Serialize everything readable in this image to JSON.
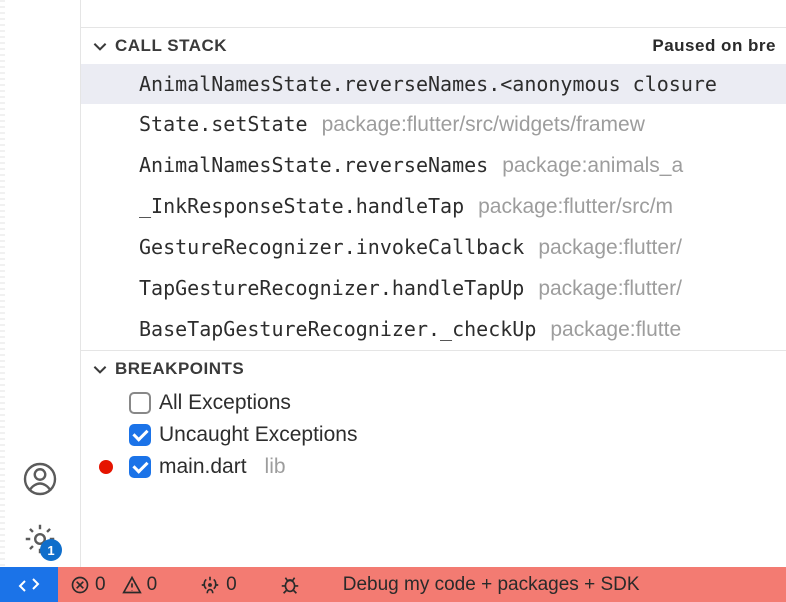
{
  "callStack": {
    "title": "CALL STACK",
    "status": "Paused on bre",
    "frames": [
      {
        "name": "AnimalNamesState.reverseNames.<anonymous closure",
        "pkg": "",
        "selected": true
      },
      {
        "name": "State.setState",
        "pkg": "package:flutter/src/widgets/framew"
      },
      {
        "name": "AnimalNamesState.reverseNames",
        "pkg": "package:animals_a"
      },
      {
        "name": "_InkResponseState.handleTap",
        "pkg": "package:flutter/src/m"
      },
      {
        "name": "GestureRecognizer.invokeCallback",
        "pkg": "package:flutter/"
      },
      {
        "name": "TapGestureRecognizer.handleTapUp",
        "pkg": "package:flutter/"
      },
      {
        "name": "BaseTapGestureRecognizer._checkUp",
        "pkg": "package:flutte"
      }
    ]
  },
  "breakpoints": {
    "title": "BREAKPOINTS",
    "items": [
      {
        "label": "All Exceptions",
        "checked": false,
        "dot": false
      },
      {
        "label": "Uncaught Exceptions",
        "checked": true,
        "dot": false
      },
      {
        "label": "main.dart",
        "sub": "lib",
        "checked": true,
        "dot": true
      }
    ]
  },
  "activityBadge": "1",
  "statusBar": {
    "errors": "0",
    "warnings": "0",
    "ports": "0",
    "debugTarget": "Debug my code + packages + SDK"
  }
}
